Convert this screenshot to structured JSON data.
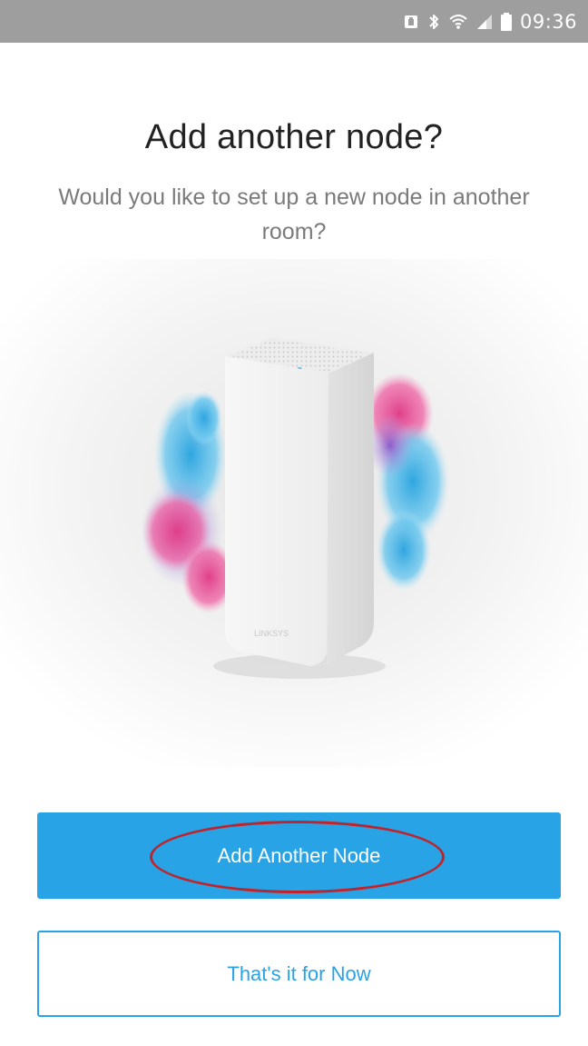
{
  "status_bar": {
    "time": "09:36",
    "icons": [
      "notification-icon",
      "bluetooth-icon",
      "wifi-icon",
      "signal-icon",
      "battery-icon"
    ],
    "background": "#9e9e9e"
  },
  "header": {
    "title": "Add another node?",
    "subtitle": "Would you like to set up a new node in another room?"
  },
  "hero": {
    "device_brand": "LINKSYS"
  },
  "actions": {
    "primary_label": "Add Another Node",
    "secondary_label": "That's it for Now",
    "accent_color": "#27a3e6",
    "annotation_color": "#c0242b"
  }
}
